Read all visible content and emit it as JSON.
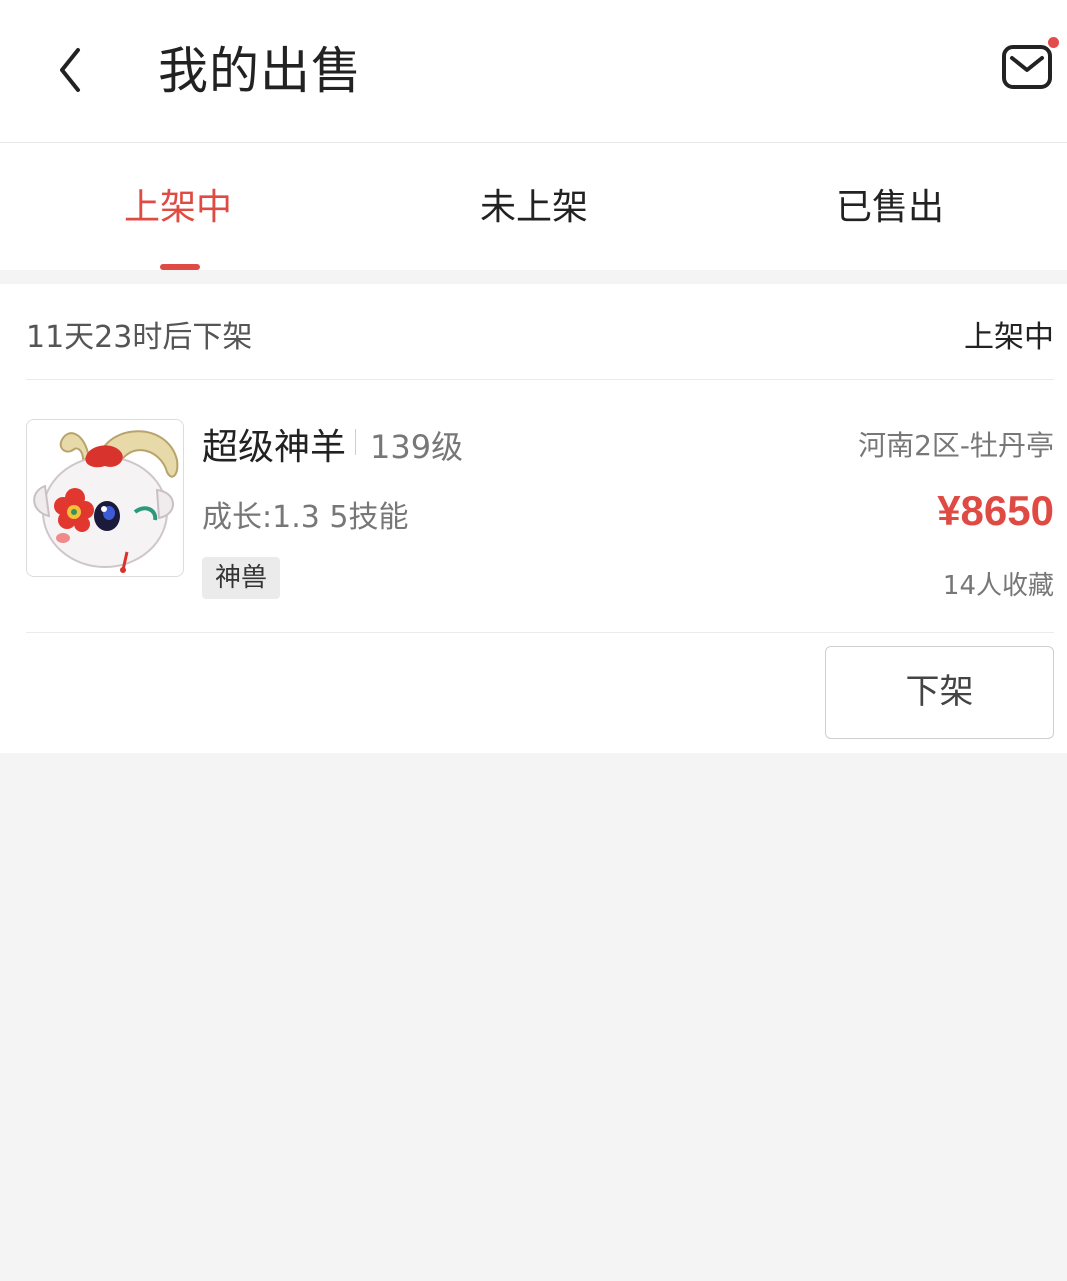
{
  "header": {
    "title": "我的出售",
    "back_icon": "chevron-left-icon",
    "mail_icon": "mail-icon",
    "mail_has_unread": true
  },
  "tabs": [
    {
      "label": "上架中",
      "active": true
    },
    {
      "label": "未上架",
      "active": false
    },
    {
      "label": "已售出",
      "active": false
    }
  ],
  "listing": {
    "delist_countdown": "11天23时后下架",
    "status": "上架中",
    "pet": {
      "name": "超级神羊",
      "level": "139级",
      "stats": "成长:1.3 5技能",
      "tag": "神兽"
    },
    "server": "河南2区-牡丹亭",
    "price": "¥8650",
    "favorites": "14人收藏",
    "action_label": "下架"
  },
  "colors": {
    "accent": "#df4b43",
    "background": "#f4f4f4",
    "card": "#ffffff"
  }
}
